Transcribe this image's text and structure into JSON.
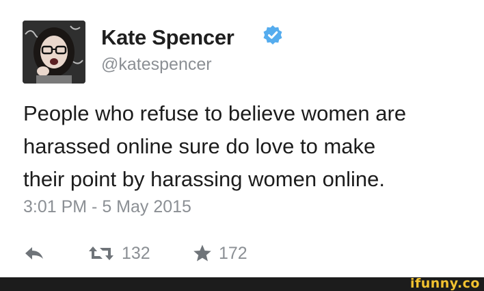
{
  "tweet": {
    "author": {
      "display_name": "Kate Spencer",
      "handle": "@katespencer",
      "verified": true,
      "avatar_icon": "profile-photo"
    },
    "text_lines": [
      "People who refuse to believe women are",
      "harassed online sure do love to make",
      "their point by harassing women online."
    ],
    "timestamp": "3:01 PM - 5 May 2015",
    "actions": {
      "reply_icon": "reply-arrow-icon",
      "retweet_icon": "retweet-icon",
      "retweet_count": "132",
      "favorite_icon": "star-icon",
      "favorite_count": "172"
    }
  },
  "watermark": {
    "text": "ifunny.co",
    "color": "#f2c230"
  },
  "colors": {
    "verified_badge": "#55acee",
    "muted_text": "#8b8f94",
    "footer_bar": "#1c1c1c"
  }
}
